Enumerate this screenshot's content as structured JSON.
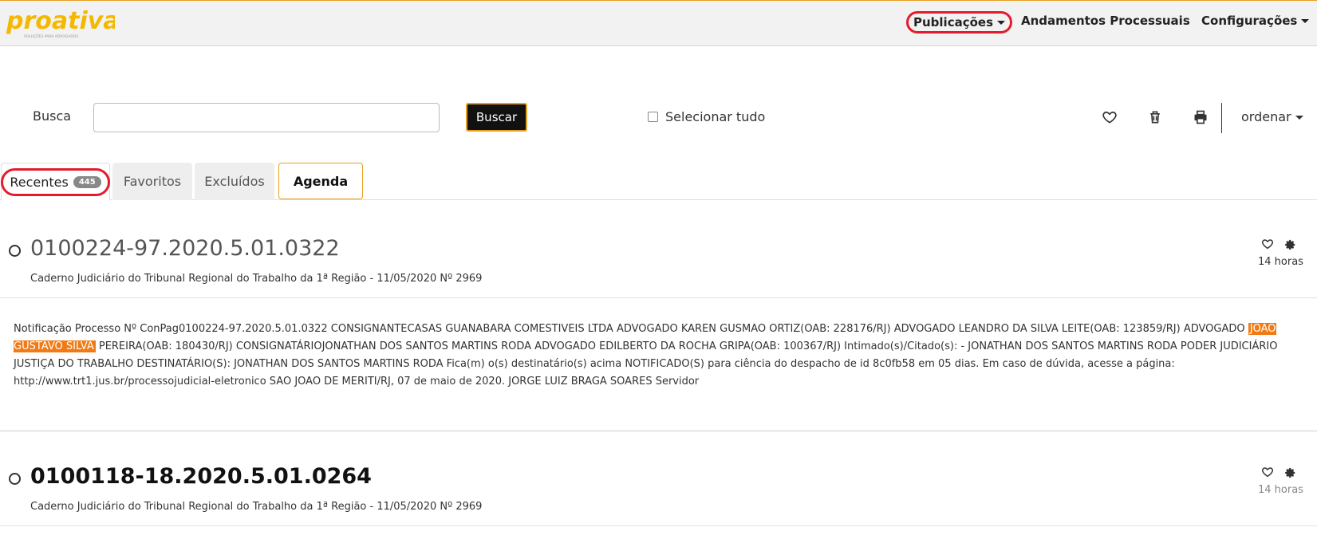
{
  "navbar": {
    "logo_text": "proativa",
    "logo_tagline": "SOLUÇÕES PARA ADVOGADOS",
    "items": [
      {
        "label": "Publicações"
      },
      {
        "label": "Andamentos Processuais"
      },
      {
        "label": "Configurações"
      }
    ]
  },
  "search": {
    "label": "Busca",
    "input_value": "",
    "button_label": "Buscar",
    "select_all_label": "Selecionar tudo",
    "sort_label": "ordenar"
  },
  "tabs": [
    {
      "label": "Recentes",
      "badge": "445"
    },
    {
      "label": "Favoritos"
    },
    {
      "label": "Excluídos"
    },
    {
      "label": "Agenda"
    }
  ],
  "publications": [
    {
      "number": "0100224-97.2020.5.01.0322",
      "caderno": "Caderno Judiciário do Tribunal Regional do Trabalho da 1ª Região - 11/05/2020 Nº 2969",
      "time": "14 horas",
      "text_before": "Notificação Processo Nº ConPag0100224-97.2020.5.01.0322 CONSIGNANTECASAS GUANABARA COMESTIVEIS LTDA ADVOGADO KAREN GUSMAO ORTIZ(OAB: 228176/RJ) ADVOGADO LEANDRO DA SILVA LEITE(OAB: 123859/RJ) ADVOGADO ",
      "text_highlight": "JOAO GUSTAVO SILVA",
      "text_after": " PEREIRA(OAB: 180430/RJ) CONSIGNATÁRIOJONATHAN DOS SANTOS MARTINS RODA ADVOGADO EDILBERTO DA ROCHA GRIPA(OAB: 100367/RJ) Intimado(s)/Citado(s): - JONATHAN DOS SANTOS MARTINS RODA PODER JUDICIÁRIO JUSTIÇA DO TRABALHO DESTINATÁRIO(S): JONATHAN DOS SANTOS MARTINS RODA Fica(m) o(s) destinatário(s) acima NOTIFICADO(S) para ciência do despacho de id 8c0fb58 em 05 dias. Em caso de dúvida, acesse a página: http://www.trt1.jus.br/processojudicial-eletronico SAO JOAO DE MERITI/RJ, 07 de maio de 2020. JORGE LUIZ BRAGA SOARES Servidor"
    },
    {
      "number": "0100118-18.2020.5.01.0264",
      "caderno": "Caderno Judiciário do Tribunal Regional do Trabalho da 1ª Região - 11/05/2020 Nº 2969",
      "time": "14 horas"
    }
  ],
  "colors": {
    "accent_orange": "#e8a020",
    "highlight": "#f07b16",
    "annotation_red": "#e31b2d"
  }
}
